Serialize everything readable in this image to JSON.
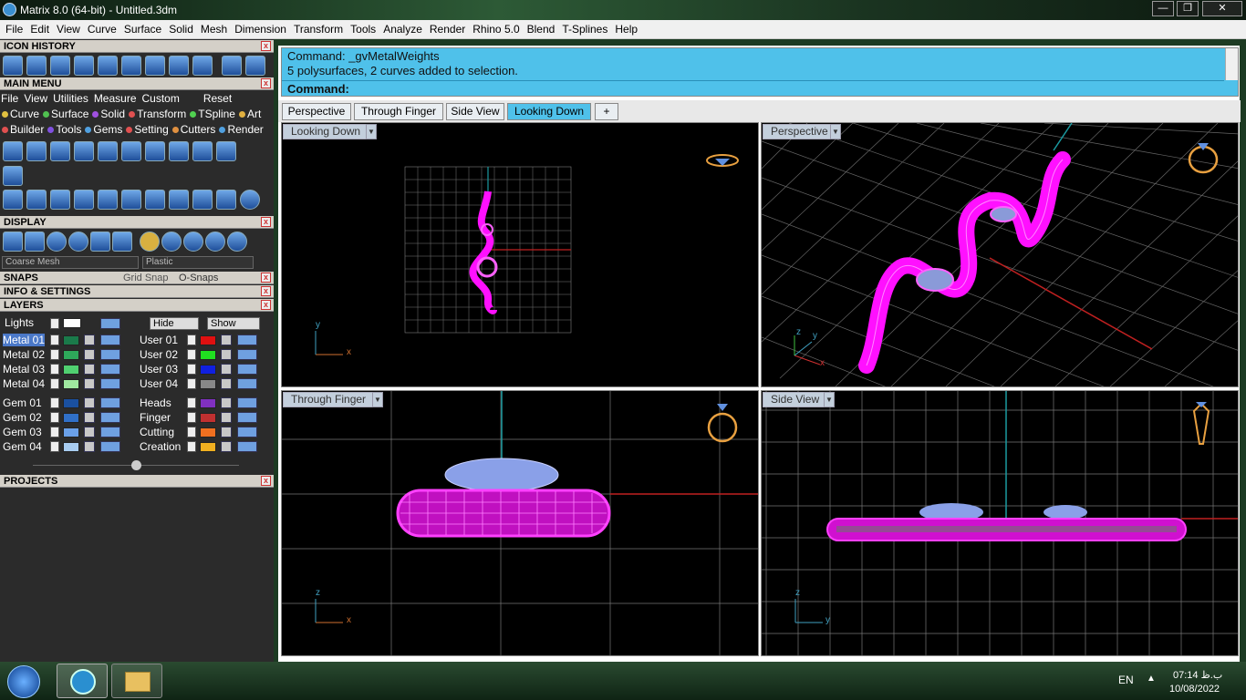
{
  "window": {
    "title": "Matrix 8.0 (64-bit) - Untitled.3dm"
  },
  "menubar": {
    "items": [
      "File",
      "Edit",
      "View",
      "Curve",
      "Surface",
      "Solid",
      "Mesh",
      "Dimension",
      "Transform",
      "Tools",
      "Analyze",
      "Render",
      "Rhino 5.0",
      "Blend",
      "T-Splines",
      "Help"
    ]
  },
  "panels": {
    "icon_history": "ICON HISTORY",
    "main_menu": "MAIN MENU",
    "display": "DISPLAY",
    "snaps": "SNAPS",
    "info": "INFO & SETTINGS",
    "layers": "LAYERS",
    "projects": "PROJECTS"
  },
  "main_menu": {
    "items": [
      "File",
      "View",
      "Utilities",
      "Measure",
      "Custom"
    ],
    "reset": "Reset",
    "cats_row1": [
      {
        "label": "Curve",
        "color": "#e0c040"
      },
      {
        "label": "Surface",
        "color": "#50c050"
      },
      {
        "label": "Solid",
        "color": "#a050e0"
      },
      {
        "label": "Transform",
        "color": "#e05050"
      },
      {
        "label": "TSpline",
        "color": "#50d050"
      },
      {
        "label": "Art",
        "color": "#e0b040"
      }
    ],
    "cats_row2": [
      {
        "label": "Builder",
        "color": "#e05050"
      },
      {
        "label": "Tools",
        "color": "#8050e0"
      },
      {
        "label": "Gems",
        "color": "#50a0e0"
      },
      {
        "label": "Setting",
        "color": "#e05050"
      },
      {
        "label": "Cutters",
        "color": "#e09040"
      },
      {
        "label": "Render",
        "color": "#50a0e0"
      }
    ]
  },
  "display": {
    "mesh": "Coarse Mesh",
    "material": "Plastic"
  },
  "snaps": {
    "grid": "Grid Snap",
    "osnaps": "O-Snaps"
  },
  "layers": {
    "lights": "Lights",
    "hide": "Hide",
    "show": "Show",
    "left": [
      {
        "name": "Metal 01",
        "color": "#1a7a4a"
      },
      {
        "name": "Metal 02",
        "color": "#2ea85a"
      },
      {
        "name": "Metal 03",
        "color": "#50d070"
      },
      {
        "name": "Metal 04",
        "color": "#a0e8a0"
      },
      {
        "name": "Gem 01",
        "color": "#1a50a0"
      },
      {
        "name": "Gem 02",
        "color": "#3070c8"
      },
      {
        "name": "Gem 03",
        "color": "#6aa0e8"
      },
      {
        "name": "Gem 04",
        "color": "#a8ccf0"
      }
    ],
    "right": [
      {
        "name": "User 01",
        "color": "#e01010"
      },
      {
        "name": "User 02",
        "color": "#20e020"
      },
      {
        "name": "User 03",
        "color": "#1020e0"
      },
      {
        "name": "User 04",
        "color": "#888888"
      },
      {
        "name": "Heads",
        "color": "#8030c0"
      },
      {
        "name": "Finger",
        "color": "#c03030"
      },
      {
        "name": "Cutting",
        "color": "#f07020"
      },
      {
        "name": "Creation",
        "color": "#f0b020"
      }
    ]
  },
  "command": {
    "line1": "Command: _gvMetalWeights",
    "line2": "5 polysurfaces, 2 curves added to selection.",
    "prompt": "Command:"
  },
  "tabs": [
    "Perspective",
    "Through Finger",
    "Side View",
    "Looking Down"
  ],
  "viewports": {
    "tl": "Looking Down",
    "tr": "Perspective",
    "bl": "Through Finger",
    "br": "Side View"
  },
  "axes": {
    "x": "x",
    "y": "y",
    "z": "z"
  },
  "tray": {
    "lang": "EN",
    "time": "07:14 ب.ظ",
    "date": "10/08/2022"
  }
}
